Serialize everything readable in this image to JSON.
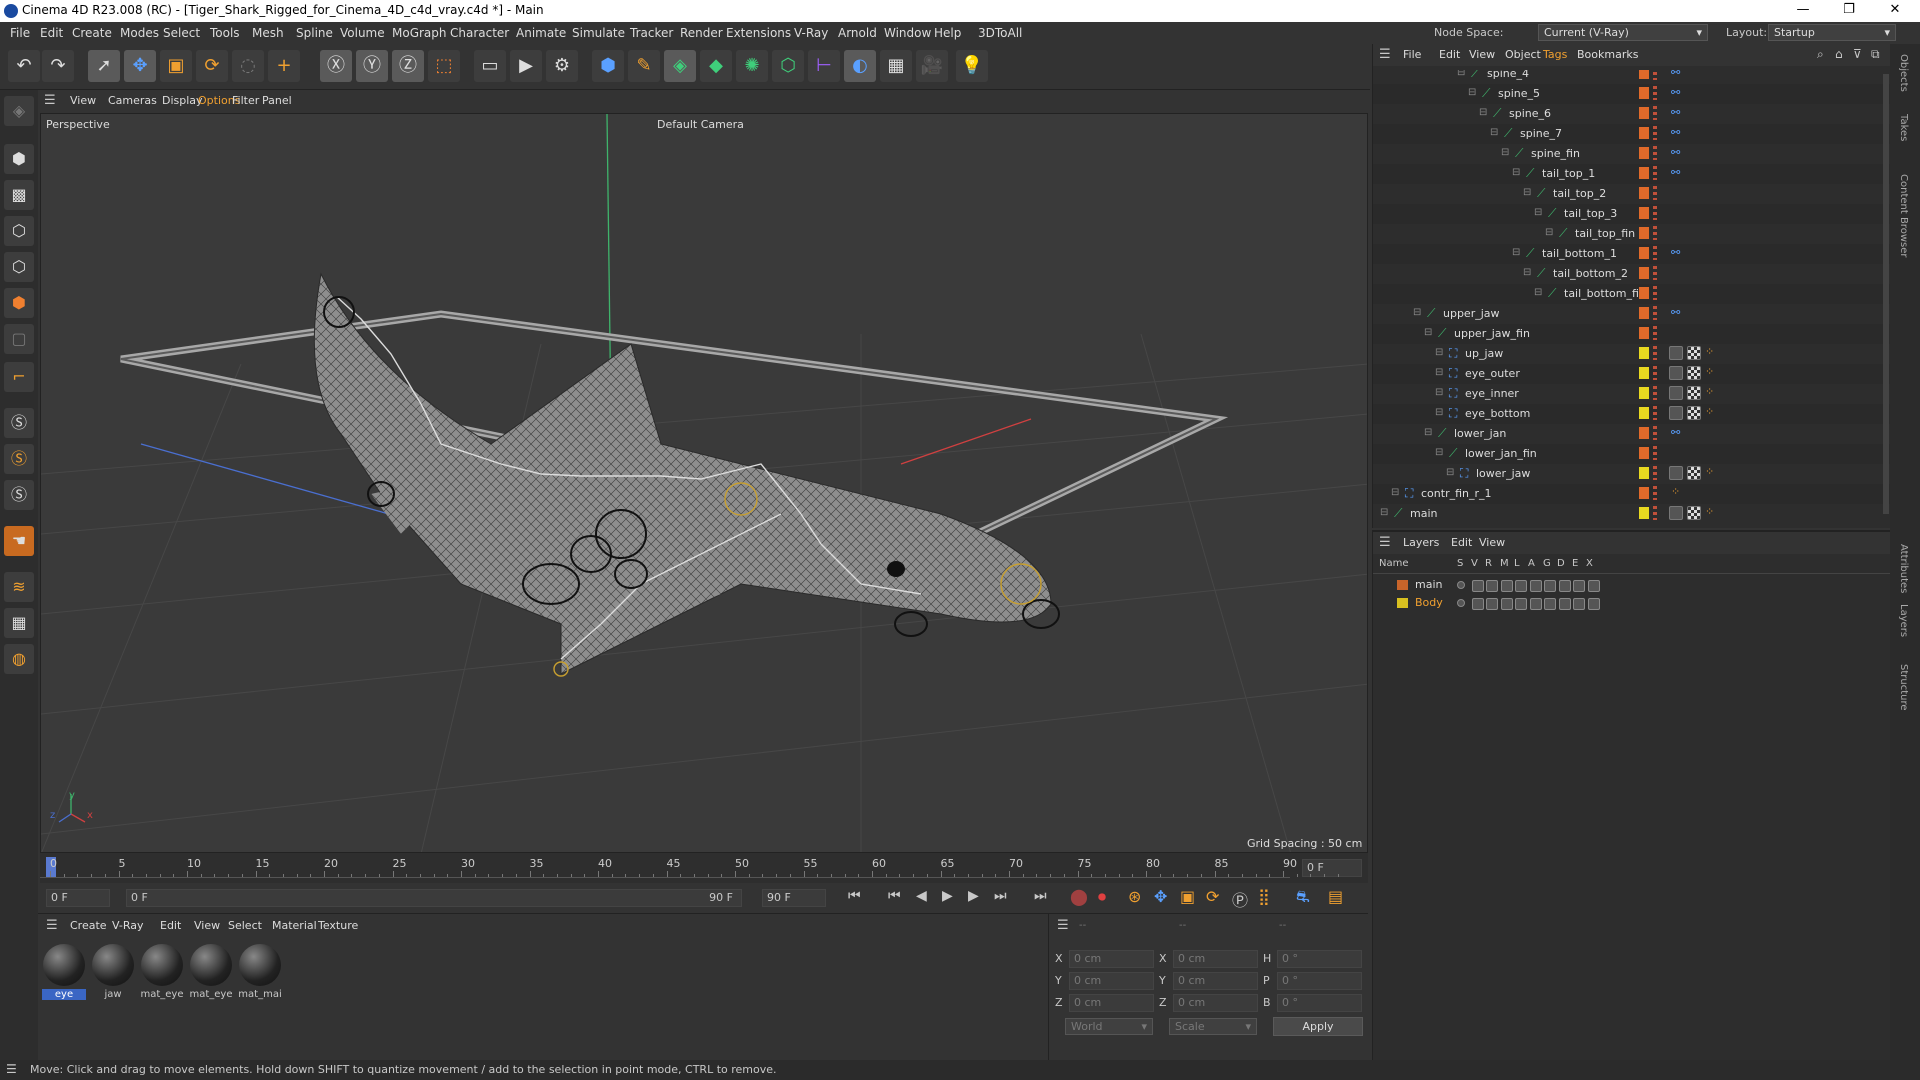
{
  "title": "Cinema 4D R23.008 (RC) - [Tiger_Shark_Rigged_for_Cinema_4D_c4d_vray.c4d *] - Main",
  "menu": [
    "File",
    "Edit",
    "Create",
    "Modes",
    "Select",
    "Tools",
    "Mesh",
    "Spline",
    "Volume",
    "MoGraph",
    "Character",
    "Animate",
    "Simulate",
    "Tracker",
    "Render",
    "Extensions",
    "V-Ray",
    "Arnold",
    "Window",
    "Help",
    "3DToAll"
  ],
  "node_space": {
    "label": "Node Space:",
    "value": "Current (V-Ray)"
  },
  "layout": {
    "label": "Layout:",
    "value": "Startup"
  },
  "view_menu": [
    "View",
    "Cameras",
    "Display",
    "Options",
    "Filter",
    "Panel"
  ],
  "viewport": {
    "label": "Perspective",
    "camera": "Default Camera",
    "grid": "Grid Spacing : 50 cm"
  },
  "timeline": {
    "ticks": [
      "0",
      "5",
      "10",
      "15",
      "20",
      "25",
      "30",
      "35",
      "40",
      "45",
      "50",
      "55",
      "60",
      "65",
      "70",
      "75",
      "80",
      "85",
      "90"
    ],
    "end_frame": "0 F"
  },
  "playback": {
    "current": "0 F",
    "start": "0 F",
    "end": "90 F",
    "end2": "90 F"
  },
  "mat_menu": [
    "Create",
    "V-Ray",
    "Edit",
    "View",
    "Select",
    "Material",
    "Texture"
  ],
  "materials": [
    "eye",
    "jaw",
    "mat_eye",
    "mat_eye",
    "mat_mai"
  ],
  "coords": {
    "x_label": "X",
    "y_label": "Y",
    "z_label": "Z",
    "h_label": "H",
    "p_label": "P",
    "b_label": "B",
    "x": "0 cm",
    "y": "0 cm",
    "z": "0 cm",
    "sx": "0 cm",
    "sy": "0 cm",
    "sz": "0 cm",
    "h": "0 °",
    "p": "0 °",
    "b": "0 °",
    "world": "World",
    "scale": "Scale",
    "apply": "Apply",
    "dash1": "--",
    "dash2": "--",
    "dash3": "--"
  },
  "status": "Move: Click and drag to move elements. Hold down SHIFT to quantize movement / add to the selection in point mode, CTRL to remove.",
  "obj_menu": [
    "File",
    "Edit",
    "View",
    "Object",
    "Tags",
    "Bookmarks"
  ],
  "objects": [
    {
      "name": "spine_4",
      "indent": 8
    },
    {
      "name": "spine_5",
      "indent": 9
    },
    {
      "name": "spine_6",
      "indent": 10
    },
    {
      "name": "spine_7",
      "indent": 11
    },
    {
      "name": "spine_fin",
      "indent": 12
    },
    {
      "name": "tail_top_1",
      "indent": 13
    },
    {
      "name": "tail_top_2",
      "indent": 14
    },
    {
      "name": "tail_top_3",
      "indent": 15
    },
    {
      "name": "tail_top_fin",
      "indent": 16
    },
    {
      "name": "tail_bottom_1",
      "indent": 13
    },
    {
      "name": "tail_bottom_2",
      "indent": 14
    },
    {
      "name": "tail_bottom_fin",
      "indent": 15
    },
    {
      "name": "upper_jaw",
      "indent": 4
    },
    {
      "name": "upper_jaw_fin",
      "indent": 5
    },
    {
      "name": "up_jaw",
      "indent": 6
    },
    {
      "name": "eye_outer",
      "indent": 6
    },
    {
      "name": "eye_inner",
      "indent": 6
    },
    {
      "name": "eye_bottom",
      "indent": 6
    },
    {
      "name": "lower_jan",
      "indent": 5
    },
    {
      "name": "lower_jan_fin",
      "indent": 6
    },
    {
      "name": "lower_jaw",
      "indent": 7
    },
    {
      "name": "contr_fin_r_1",
      "indent": 2
    },
    {
      "name": "main",
      "indent": 1
    }
  ],
  "layer_menu": [
    "Layers",
    "Edit",
    "View"
  ],
  "layer_headers": [
    "Name",
    "S",
    "V",
    "R",
    "M",
    "L",
    "A",
    "G",
    "D",
    "E",
    "X"
  ],
  "layers": [
    {
      "name": "main",
      "color": "#c8642a"
    },
    {
      "name": "Body",
      "color": "#d8c020"
    }
  ],
  "side_tabs": [
    "Objects",
    "Takes",
    "Content Browser",
    "Attributes",
    "Layers",
    "Structure"
  ],
  "colors": {
    "accent": "#3a66c4",
    "tag_orange": "#e06a2a",
    "tag_yellow": "#e8d820",
    "bone_green": "#3fb36b",
    "mesh": "#9a9a9a"
  }
}
